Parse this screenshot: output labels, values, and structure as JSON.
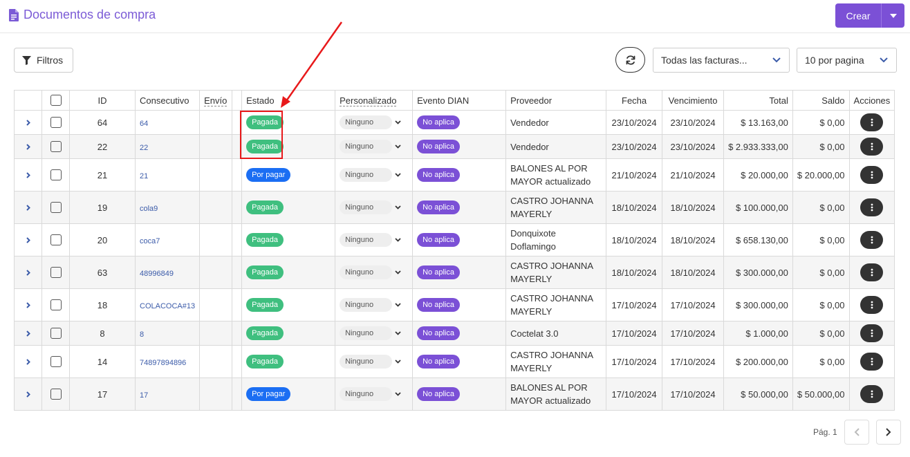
{
  "header": {
    "title": "Documentos de compra",
    "create_label": "Crear"
  },
  "toolbar": {
    "filters_label": "Filtros",
    "invoice_filter": "Todas las facturas...",
    "per_page": "10 por pagina"
  },
  "table": {
    "headers": {
      "id": "ID",
      "consecutivo": "Consecutivo",
      "envio": "Envío",
      "estado": "Estado",
      "personalizado": "Personalizado",
      "evento": "Evento DIAN",
      "proveedor": "Proveedor",
      "fecha": "Fecha",
      "vencimiento": "Vencimiento",
      "total": "Total",
      "saldo": "Saldo",
      "acciones": "Acciones"
    },
    "rows": [
      {
        "id": "64",
        "consecutivo": "64",
        "estado": "Pagada",
        "estado_type": "green",
        "personalizado": "Ninguno",
        "evento": "No aplica",
        "proveedor_l1": "Vendedor",
        "proveedor_l2": "",
        "fecha": "23/10/2024",
        "vencimiento": "23/10/2024",
        "total": "$ 13.163,00",
        "saldo": "$ 0,00"
      },
      {
        "id": "22",
        "consecutivo": "22",
        "estado": "Pagada",
        "estado_type": "green",
        "personalizado": "Ninguno",
        "evento": "No aplica",
        "proveedor_l1": "Vendedor",
        "proveedor_l2": "",
        "fecha": "23/10/2024",
        "vencimiento": "23/10/2024",
        "total": "$ 2.933.333,00",
        "saldo": "$ 0,00"
      },
      {
        "id": "21",
        "consecutivo": "21",
        "estado": "Por pagar",
        "estado_type": "blue",
        "personalizado": "Ninguno",
        "evento": "No aplica",
        "proveedor_l1": "BALONES AL POR",
        "proveedor_l2": "MAYOR actualizado",
        "fecha": "21/10/2024",
        "vencimiento": "21/10/2024",
        "total": "$ 20.000,00",
        "saldo": "$ 20.000,00"
      },
      {
        "id": "19",
        "consecutivo": "cola9",
        "estado": "Pagada",
        "estado_type": "green",
        "personalizado": "Ninguno",
        "evento": "No aplica",
        "proveedor_l1": "CASTRO JOHANNA",
        "proveedor_l2": "MAYERLY",
        "fecha": "18/10/2024",
        "vencimiento": "18/10/2024",
        "total": "$ 100.000,00",
        "saldo": "$ 0,00"
      },
      {
        "id": "20",
        "consecutivo": "coca7",
        "estado": "Pagada",
        "estado_type": "green",
        "personalizado": "Ninguno",
        "evento": "No aplica",
        "proveedor_l1": "Donquixote",
        "proveedor_l2": "Doflamingo",
        "fecha": "18/10/2024",
        "vencimiento": "18/10/2024",
        "total": "$ 658.130,00",
        "saldo": "$ 0,00"
      },
      {
        "id": "63",
        "consecutivo": "48996849",
        "estado": "Pagada",
        "estado_type": "green",
        "personalizado": "Ninguno",
        "evento": "No aplica",
        "proveedor_l1": "CASTRO JOHANNA",
        "proveedor_l2": "MAYERLY",
        "fecha": "18/10/2024",
        "vencimiento": "18/10/2024",
        "total": "$ 300.000,00",
        "saldo": "$ 0,00"
      },
      {
        "id": "18",
        "consecutivo": "COLACOCA#13",
        "estado": "Pagada",
        "estado_type": "green",
        "personalizado": "Ninguno",
        "evento": "No aplica",
        "proveedor_l1": "CASTRO JOHANNA",
        "proveedor_l2": "MAYERLY",
        "fecha": "17/10/2024",
        "vencimiento": "17/10/2024",
        "total": "$ 300.000,00",
        "saldo": "$ 0,00"
      },
      {
        "id": "8",
        "consecutivo": "8",
        "estado": "Pagada",
        "estado_type": "green",
        "personalizado": "Ninguno",
        "evento": "No aplica",
        "proveedor_l1": "Coctelat 3.0",
        "proveedor_l2": "",
        "fecha": "17/10/2024",
        "vencimiento": "17/10/2024",
        "total": "$ 1.000,00",
        "saldo": "$ 0,00"
      },
      {
        "id": "14",
        "consecutivo": "74897894896",
        "estado": "Pagada",
        "estado_type": "green",
        "personalizado": "Ninguno",
        "evento": "No aplica",
        "proveedor_l1": "CASTRO JOHANNA",
        "proveedor_l2": "MAYERLY",
        "fecha": "17/10/2024",
        "vencimiento": "17/10/2024",
        "total": "$ 200.000,00",
        "saldo": "$ 0,00"
      },
      {
        "id": "17",
        "consecutivo": "17",
        "estado": "Por pagar",
        "estado_type": "blue",
        "personalizado": "Ninguno",
        "evento": "No aplica",
        "proveedor_l1": "BALONES AL POR",
        "proveedor_l2": "MAYOR actualizado",
        "fecha": "17/10/2024",
        "vencimiento": "17/10/2024",
        "total": "$ 50.000,00",
        "saldo": "$ 50.000,00"
      }
    ]
  },
  "pagination": {
    "label": "Pág. 1"
  },
  "colors": {
    "brand": "#7b50d6",
    "paid": "#3fbf7f",
    "pending": "#1b6ef3",
    "annotation": "#e8191b"
  }
}
